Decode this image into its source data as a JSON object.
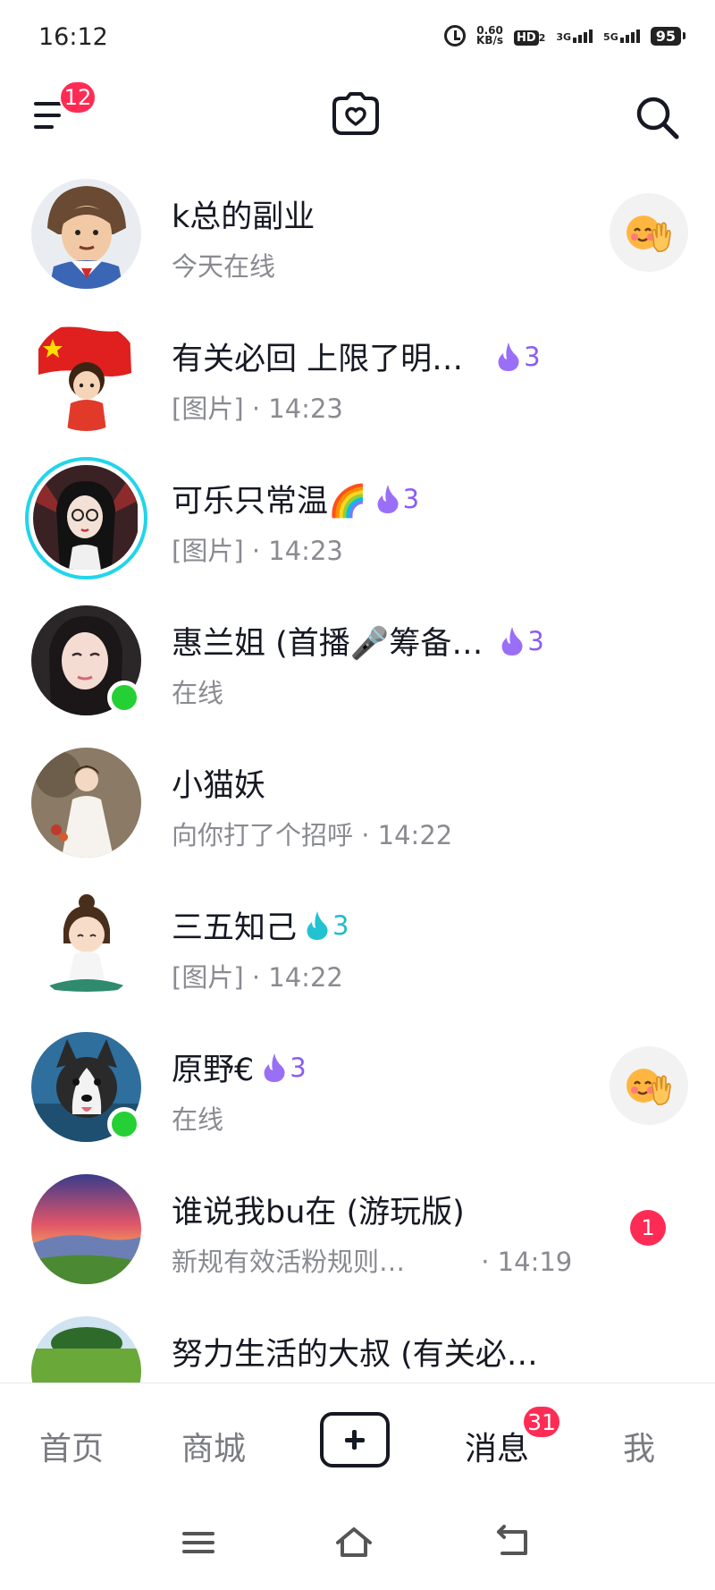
{
  "status_bar": {
    "time": "16:12",
    "net_speed_value": "0.60",
    "net_speed_unit": "KB/s",
    "hd_label": "HD",
    "hd_sub": "2",
    "sig1_label": "3G",
    "sig2_label": "5G",
    "battery": "95"
  },
  "header": {
    "menu_badge": "12"
  },
  "chats": [
    {
      "name": "k总的副业",
      "sub": "今天在线",
      "avatar": "avatar-cartoon-sailor"
    },
    {
      "name": "有关必回 上限了明…",
      "spark": "3",
      "sub": "[图片] · 14:23",
      "avatar": "avatar-flag-girl"
    },
    {
      "name": "可乐只常温🌈",
      "spark": "3",
      "sub": "[图片] · 14:23",
      "avatar": "avatar-glasses-girl"
    },
    {
      "name": "惠兰姐 (首播🎤筹备…",
      "spark": "3",
      "sub": "在线",
      "avatar": "avatar-woman-photo"
    },
    {
      "name": "小猫妖",
      "sub": "向你打了个招呼 · 14:22",
      "avatar": "avatar-white-dress"
    },
    {
      "name": "三五知己",
      "spark": "3",
      "sub": "[图片] · 14:22",
      "avatar": "avatar-sitting-girl"
    },
    {
      "name": "原野€",
      "spark": "3",
      "sub": "在线",
      "avatar": "avatar-husky"
    },
    {
      "name": "谁说我bu在 (游玩版)",
      "sub": "新规有效活粉规则…",
      "sub_time": "· 14:19",
      "unread": "1",
      "avatar": "avatar-sunset"
    },
    {
      "name": "努力生活的大叔 (有关必…",
      "avatar": "avatar-green-field"
    }
  ],
  "bottom_nav": {
    "home": "首页",
    "mall": "商城",
    "messages": "消息",
    "messages_badge": "31",
    "me": "我"
  },
  "colors": {
    "badge": "#fe2c55",
    "online": "#25d034",
    "spark_purple": "#8a5cf5",
    "spark_teal": "#1fbcc9",
    "story_ring": "#20d5ec"
  }
}
